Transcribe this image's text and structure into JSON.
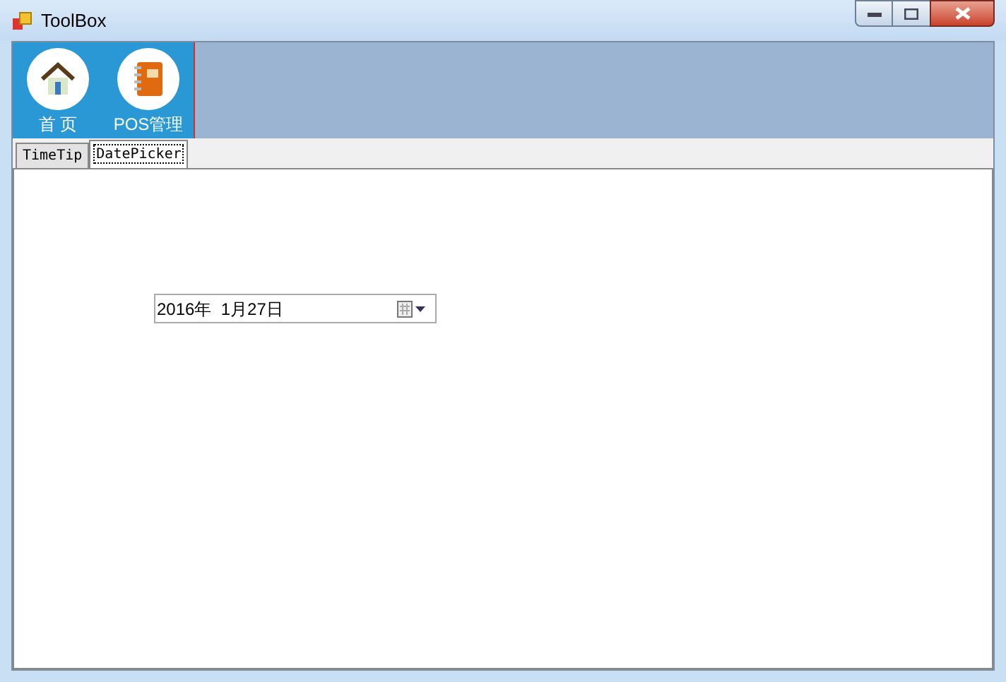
{
  "window": {
    "title": "ToolBox"
  },
  "nav_items": [
    {
      "label": "首 页",
      "kind": "home"
    },
    {
      "label": "POS管理",
      "kind": "notebook"
    }
  ],
  "tabs": [
    {
      "label": "TimeTip",
      "selected": false
    },
    {
      "label": "DatePicker",
      "selected": true
    }
  ],
  "date_picker": {
    "value": "2016年  1月27日"
  }
}
